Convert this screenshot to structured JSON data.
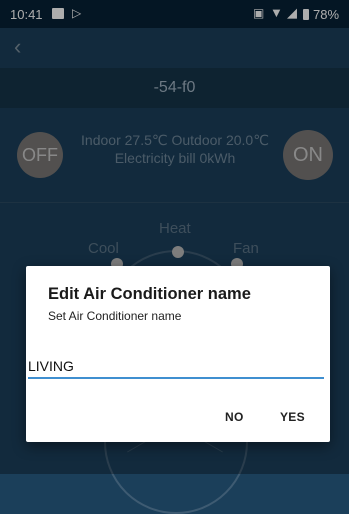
{
  "status_bar": {
    "time": "10:41",
    "battery": "78%"
  },
  "header": {
    "device_name": "-54-f0"
  },
  "controls": {
    "off_label": "OFF",
    "on_label": "ON",
    "indoor_outdoor": "Indoor 27.5℃  Outdoor 20.0℃",
    "electricity": "Electricity bill 0kWh"
  },
  "modes": {
    "heat": "Heat",
    "cool": "Cool",
    "fan": "Fan"
  },
  "dialog": {
    "title": "Edit Air Conditioner name",
    "message": "Set Air Conditioner name",
    "input_value": "LIVING",
    "no_label": "NO",
    "yes_label": "YES"
  },
  "colors": {
    "background": "#1b3f5a",
    "statusbar": "#072135",
    "accent": "#3f8fd0"
  }
}
